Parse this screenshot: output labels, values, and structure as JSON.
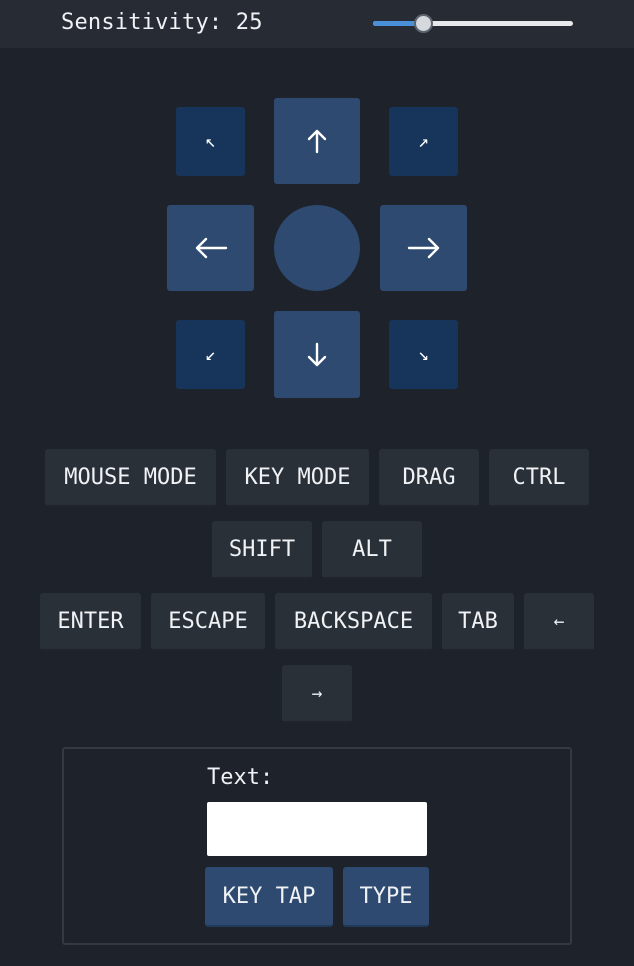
{
  "sensitivity": {
    "label": "Sensitivity: 25",
    "value": 25,
    "min": 0,
    "max": 100,
    "accent_color": "#4a90d9"
  },
  "dpad": {
    "up_left": "↖",
    "up_right": "↗",
    "down_left": "↙",
    "down_right": "↘",
    "up_icon": "arrow-up-icon",
    "down_icon": "arrow-down-icon",
    "left_icon": "arrow-left-icon",
    "right_icon": "arrow-right-icon",
    "center_icon": "center-circle"
  },
  "buttons": {
    "mouse_mode": "MOUSE MODE",
    "key_mode": "KEY MODE",
    "drag": "DRAG",
    "ctrl": "CTRL",
    "shift": "SHIFT",
    "alt": "ALT",
    "enter": "ENTER",
    "escape": "ESCAPE",
    "backspace": "BACKSPACE",
    "tab": "TAB",
    "left_arrow": "←",
    "right_arrow": "→"
  },
  "text_panel": {
    "label": "Text:",
    "input_value": "",
    "key_tap": "KEY TAP",
    "type": "TYPE"
  },
  "colors": {
    "background": "#1e222a",
    "button": "#2a3038",
    "dpad_primary": "#2e4a70",
    "dpad_diagonal": "#17345a"
  }
}
